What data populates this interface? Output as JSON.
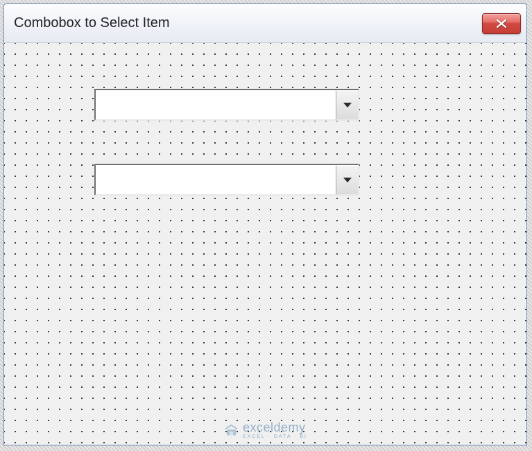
{
  "window": {
    "title": "Combobox to Select Item"
  },
  "combobox1": {
    "value": "",
    "placeholder": ""
  },
  "combobox2": {
    "value": "",
    "placeholder": ""
  },
  "watermark": {
    "brand": "exceldemy",
    "tagline": "EXCEL · DATA · BI"
  }
}
